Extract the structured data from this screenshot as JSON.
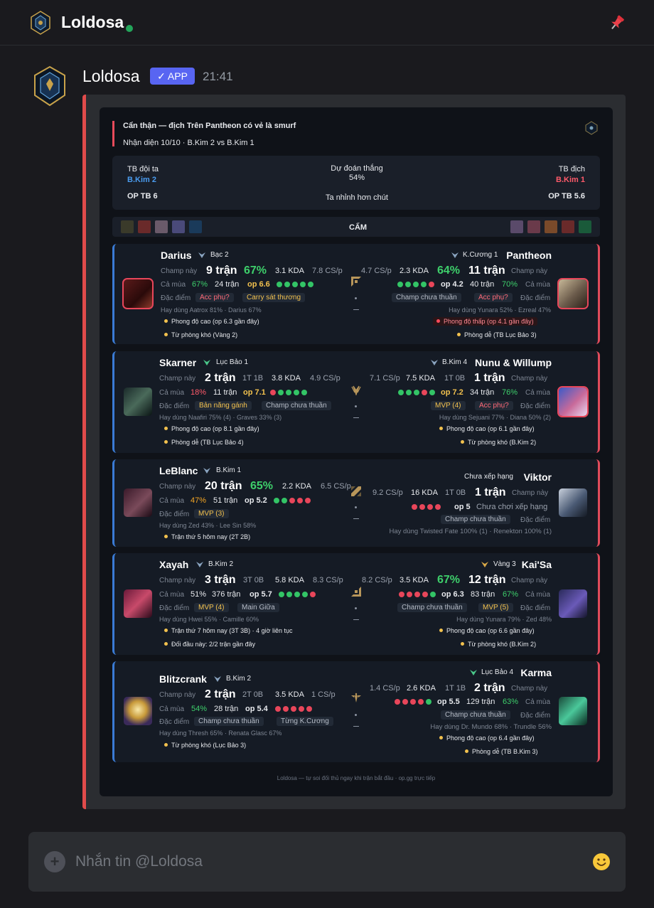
{
  "header": {
    "title": "Loldosa"
  },
  "message": {
    "author": "Loldosa",
    "badge": "✓ APP",
    "time": "21:41"
  },
  "card": {
    "title": "Cẩn thận — địch Trên Pantheon có vẻ là smurf",
    "subtitle": "Nhận diện 10/10 · B.Kim 2 vs B.Kim 1",
    "summary": {
      "left_label": "TB đội ta",
      "left_team": "B.Kim 2",
      "left_op": "OP TB 6",
      "center_label": "Dự đoán thắng",
      "center_pct": "54%",
      "center_note": "Ta nhỉnh hơn chút",
      "right_label": "TB địch",
      "right_team": "B.Kim 1",
      "right_op": "OP TB 5.6"
    },
    "bans_label": "CẤM",
    "colors": {
      "accent_red": "#e04b5b",
      "ally_blue": "#3a7bd5",
      "win": "#33c466",
      "loss": "#e8465a"
    },
    "rows": [
      {
        "role": "top",
        "left": {
          "champ": "Darius",
          "rank": "Bạc 2",
          "champ_label": "Champ này",
          "games": "9 trận",
          "wr": "67%",
          "kda": "3.1 KDA",
          "cs": "7.8 CS/p",
          "season_label": "Cả mùa",
          "season_wr": "67%",
          "season_games": "24 trận",
          "op": "op 6.6",
          "form": [
            1,
            1,
            1,
            1,
            1
          ],
          "trait_label": "Đặc điểm",
          "tags": [
            "Acc phụ?",
            "Carry sát thương"
          ],
          "uses": "Hay dùng Aatrox 81% · Darius 67%",
          "notes": [
            "Phong độ cao (op 6.3 gần đây)",
            "Từ phòng khó (Vàng 2)"
          ]
        },
        "right": {
          "champ": "Pantheon",
          "rank": "K.Cương 1",
          "champ_label": "Champ này",
          "games": "11 trận",
          "wr": "64%",
          "kda": "2.3 KDA",
          "cs": "4.7 CS/p",
          "season_label": "Cả mùa",
          "season_wr": "70%",
          "season_games": "40 trận",
          "op": "op 4.2",
          "form": [
            1,
            1,
            1,
            1,
            0
          ],
          "trait_label": "Đặc điểm",
          "tags": [
            "Champ chưa thuần",
            "Acc phụ?"
          ],
          "uses": "Hay dùng Yunara 52% · Ezreal 47%",
          "notes": [
            "Phong độ thấp (op 4.1 gần đây)",
            "Phòng dễ (TB Lục Bảo 3)"
          ]
        }
      },
      {
        "role": "jungle",
        "left": {
          "champ": "Skarner",
          "rank": "Lục Bảo 1",
          "champ_label": "Champ này",
          "games": "2 trận",
          "record": "1T 1B",
          "kda": "3.8 KDA",
          "cs": "4.9 CS/p",
          "season_label": "Cả mùa",
          "season_wr": "18%",
          "season_games": "11 trận",
          "op": "op 7.1",
          "form": [
            0,
            1,
            1,
            1,
            1
          ],
          "trait_label": "Đặc điểm",
          "tags": [
            "Bản năng gánh",
            "Champ chưa thuần"
          ],
          "uses": "Hay dùng Naafiri 75% (4) · Graves 33% (3)",
          "notes": [
            "Phong độ cao (op 8.1 gần đây)",
            "Phòng dễ (TB Lục Bảo 4)"
          ]
        },
        "right": {
          "champ": "Nunu & Willump",
          "rank": "B.Kim 4",
          "champ_label": "Champ này",
          "games": "1 trận",
          "record": "1T 0B",
          "kda": "7.5 KDA",
          "cs": "7.1 CS/p",
          "season_label": "Cả mùa",
          "season_wr": "76%",
          "season_games": "34 trận",
          "op": "op 7.2",
          "form": [
            1,
            1,
            1,
            0,
            1
          ],
          "trait_label": "Đặc điểm",
          "tags": [
            "MVP (4)",
            "Acc phụ?"
          ],
          "uses": "Hay dùng Sejuani 77% · Diana 50% (2)",
          "notes": [
            "Phong độ cao (op 6.1 gần đây)",
            "Từ phòng khó (B.Kim 2)"
          ]
        }
      },
      {
        "role": "mid",
        "left": {
          "champ": "LeBlanc",
          "rank": "B.Kim 1",
          "champ_label": "Champ này",
          "games": "20 trận",
          "wr": "65%",
          "kda": "2.2 KDA",
          "cs": "6.5 CS/p",
          "season_label": "Cả mùa",
          "season_wr": "47%",
          "season_games": "51 trận",
          "op": "op 5.2",
          "form": [
            1,
            1,
            0,
            0,
            0
          ],
          "trait_label": "Đặc điểm",
          "tags": [
            "MVP (3)"
          ],
          "uses": "Hay dùng Zed 43% · Lee Sin 58%",
          "notes": [
            "Trận thứ 5 hôm nay (2T 2B)"
          ]
        },
        "right": {
          "champ": "Viktor",
          "rank": "Chưa xếp hạng",
          "champ_label": "Champ này",
          "games": "1 trận",
          "record": "1T 0B",
          "kda": "16 KDA",
          "cs": "9.2 CS/p",
          "op": "op 5",
          "form": [
            0,
            0,
            0,
            0
          ],
          "season_text": "Chưa chơi xếp hạng",
          "trait_label": "Đặc điểm",
          "tags": [
            "Champ chưa thuần"
          ],
          "uses": "Hay dùng Twisted Fate 100% (1) · Renekton 100% (1)",
          "notes": []
        }
      },
      {
        "role": "adc",
        "left": {
          "champ": "Xayah",
          "rank": "B.Kim 2",
          "champ_label": "Champ này",
          "games": "3 trận",
          "record": "3T 0B",
          "kda": "5.8 KDA",
          "cs": "8.3 CS/p",
          "season_label": "Cả mùa",
          "season_wr": "51%",
          "season_games": "376 trận",
          "op": "op 5.7",
          "form": [
            1,
            1,
            1,
            1,
            0
          ],
          "trait_label": "Đặc điểm",
          "tags": [
            "MVP (4)",
            "Main Giữa"
          ],
          "uses": "Hay dùng Hwei 55% · Camille 60%",
          "notes": [
            "Trận thứ 7 hôm nay (3T 3B) · 4 giờ liên tục",
            "Đối đầu này: 2/2 trận gần đây"
          ]
        },
        "right": {
          "champ": "Kai'Sa",
          "rank": "Vàng 3",
          "champ_label": "Champ này",
          "games": "12 trận",
          "wr": "67%",
          "kda": "3.5 KDA",
          "cs": "8.2 CS/p",
          "season_label": "Cả mùa",
          "season_wr": "67%",
          "season_games": "83 trận",
          "op": "op 6.3",
          "form": [
            0,
            0,
            0,
            0,
            1
          ],
          "trait_label": "Đặc điểm",
          "tags": [
            "Champ chưa thuần",
            "MVP (5)"
          ],
          "uses": "Hay dùng Yunara 79% · Zed 48%",
          "notes": [
            "Phong độ cao (op 6.6 gần đây)",
            "Từ phòng khó (B.Kim 2)"
          ]
        }
      },
      {
        "role": "support",
        "left": {
          "champ": "Blitzcrank",
          "rank": "B.Kim 2",
          "champ_label": "Champ này",
          "games": "2 trận",
          "record": "2T 0B",
          "kda": "3.5 KDA",
          "cs": "1 CS/p",
          "season_label": "Cả mùa",
          "season_wr": "54%",
          "season_games": "28 trận",
          "op": "op 5.4",
          "form": [
            0,
            0,
            0,
            0,
            0
          ],
          "trait_label": "Đặc điểm",
          "tags": [
            "Champ chưa thuần",
            "Từng K.Cương"
          ],
          "uses": "Hay dùng Thresh 65% · Renata Glasc 67%",
          "notes": [
            "Từ phòng khó (Lục Bảo 3)"
          ]
        },
        "right": {
          "champ": "Karma",
          "rank": "Lục Bảo 4",
          "champ_label": "Champ này",
          "games": "2 trận",
          "record": "1T 1B",
          "kda": "2.6 KDA",
          "cs": "1.4 CS/p",
          "season_label": "Cả mùa",
          "season_wr": "63%",
          "season_games": "129 trận",
          "op": "op 5.5",
          "form": [
            0,
            0,
            0,
            0,
            1
          ],
          "trait_label": "Đặc điểm",
          "tags": [
            "Champ chưa thuần"
          ],
          "uses": "Hay dùng Dr. Mundo 68% · Trundle 56%",
          "notes": [
            "Phong độ cao (op 6.4 gần đây)",
            "Phòng dễ (TB B.Kim 3)"
          ]
        }
      }
    ],
    "footer": "Loldosa — tự soi đối thủ ngay khi trận bắt đầu · op.gg trực tiếp"
  },
  "composer": {
    "placeholder": "Nhắn tin @Loldosa"
  }
}
